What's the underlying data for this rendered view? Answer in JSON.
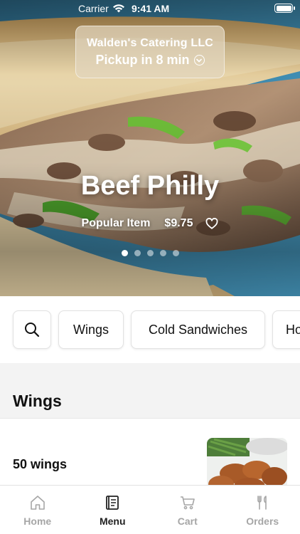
{
  "status_bar": {
    "carrier": "Carrier",
    "time": "9:41 AM"
  },
  "store": {
    "name": "Walden's Catering LLC",
    "pickup": "Pickup in 8 min"
  },
  "featured": {
    "title": "Beef Philly",
    "badge": "Popular Item",
    "price": "$9.75",
    "carousel_total": 5,
    "carousel_active": 1
  },
  "categories": [
    "Wings",
    "Cold Sandwiches",
    "Ho"
  ],
  "section": {
    "title": "Wings"
  },
  "menu_items": [
    {
      "name": "50 wings"
    }
  ],
  "tabs": [
    {
      "label": "Home",
      "icon": "home-icon",
      "active": false
    },
    {
      "label": "Menu",
      "icon": "menu-book-icon",
      "active": true
    },
    {
      "label": "Cart",
      "icon": "cart-icon",
      "active": false
    },
    {
      "label": "Orders",
      "icon": "fork-knife-icon",
      "active": false
    }
  ],
  "colors": {
    "active_tab": "#222222",
    "inactive_tab": "#a6a6a6",
    "hero_bg": "#3f8fb3"
  }
}
